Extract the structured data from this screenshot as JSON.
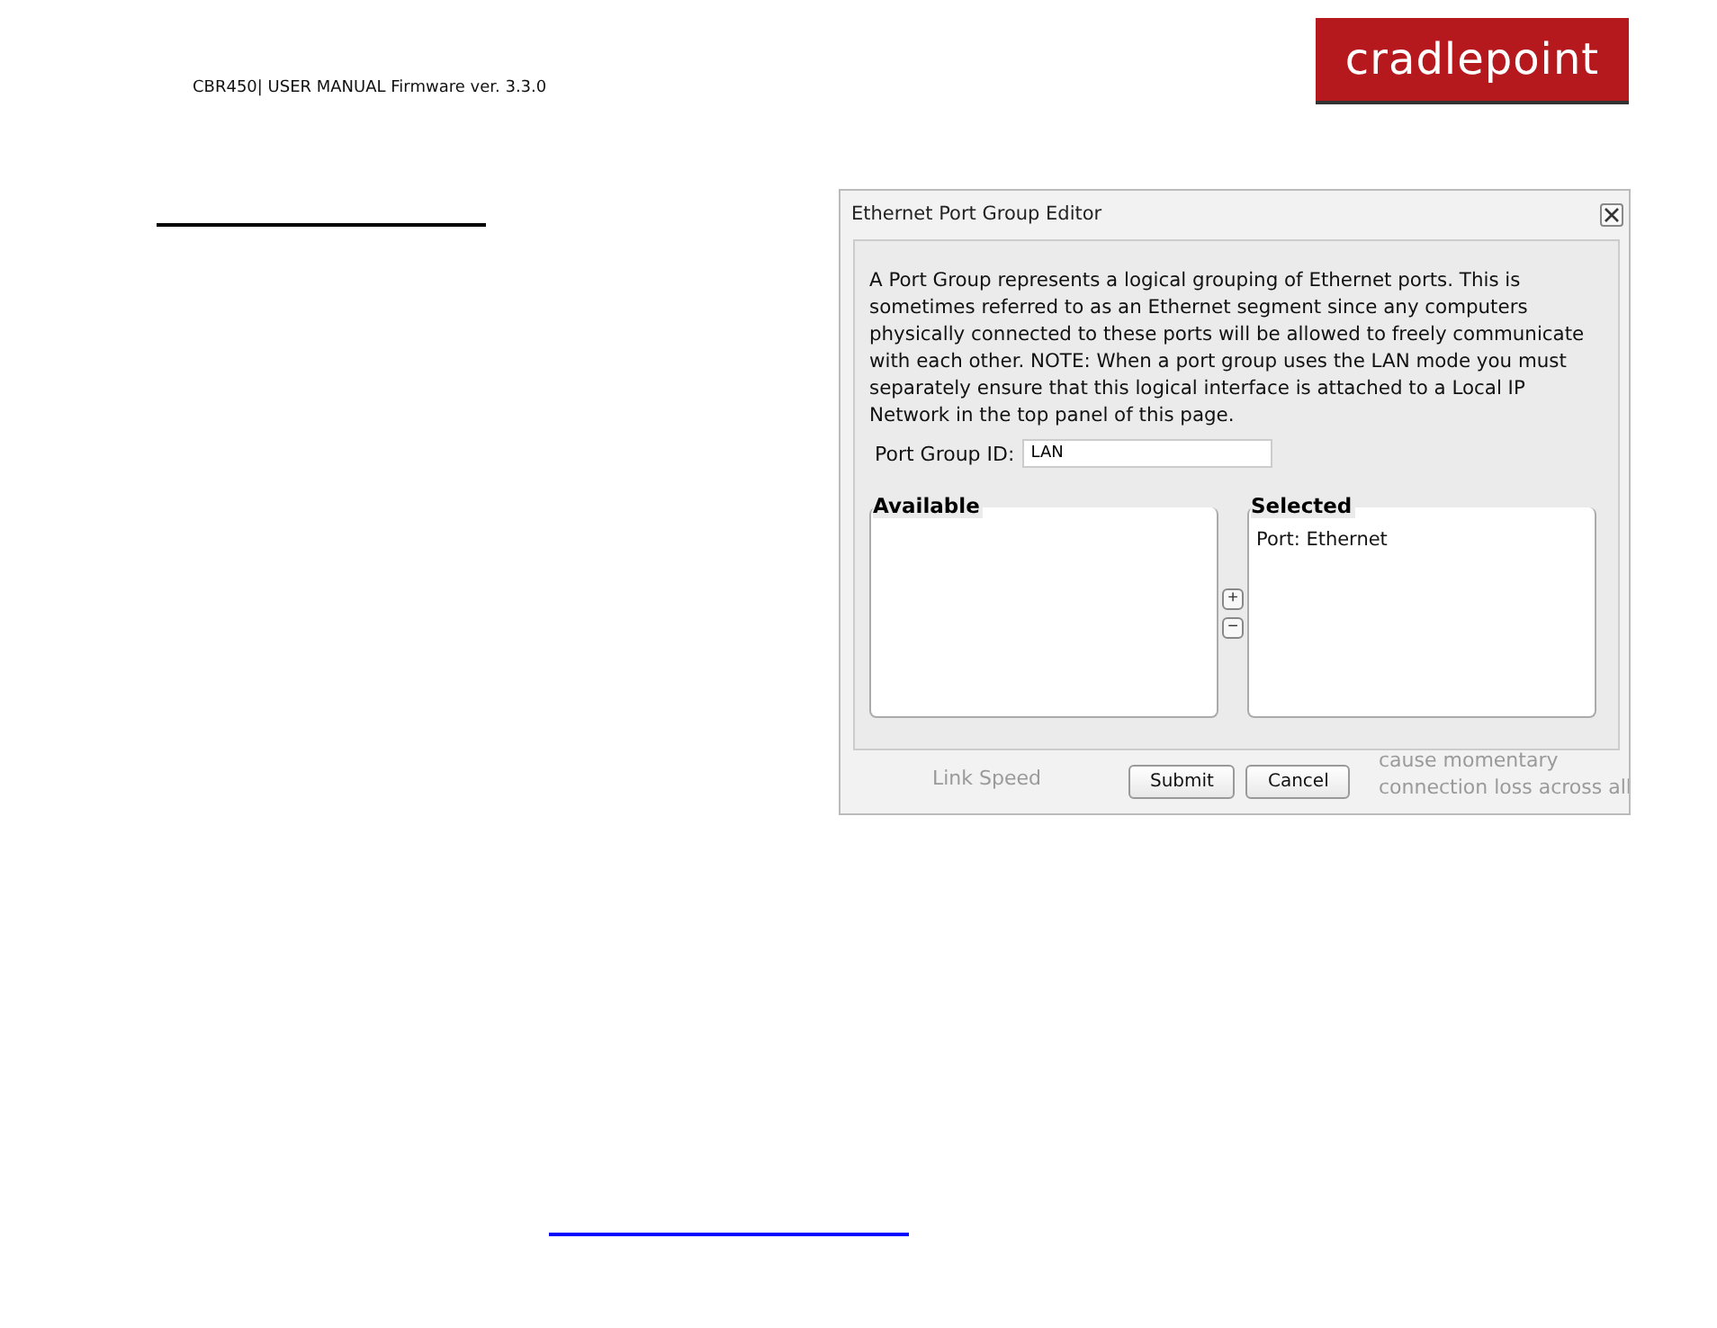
{
  "header": {
    "text": "CBR450| USER MANUAL Firmware ver. 3.3.0",
    "logo": "cradlepoint"
  },
  "dialog": {
    "title": "Ethernet Port Group Editor",
    "description": "A Port Group represents a logical grouping of Ethernet ports. This is sometimes referred to as an Ethernet segment since any computers physically connected to these ports will be allowed to freely communicate with each other. NOTE: When a port group uses the LAN mode you must separately ensure that this logical interface is attached to a Local IP Network in the top panel of this page.",
    "field": {
      "label": "Port Group ID:",
      "value": "LAN"
    },
    "available": {
      "legend": "Available"
    },
    "selected": {
      "legend": "Selected",
      "items": [
        "Port: Ethernet"
      ]
    },
    "move_buttons": [
      "+",
      "−"
    ],
    "buttons": [
      "Submit",
      "Cancel"
    ],
    "background_left": "Link Speed",
    "background_right": [
      "cause momentary",
      "connection loss across all"
    ]
  }
}
